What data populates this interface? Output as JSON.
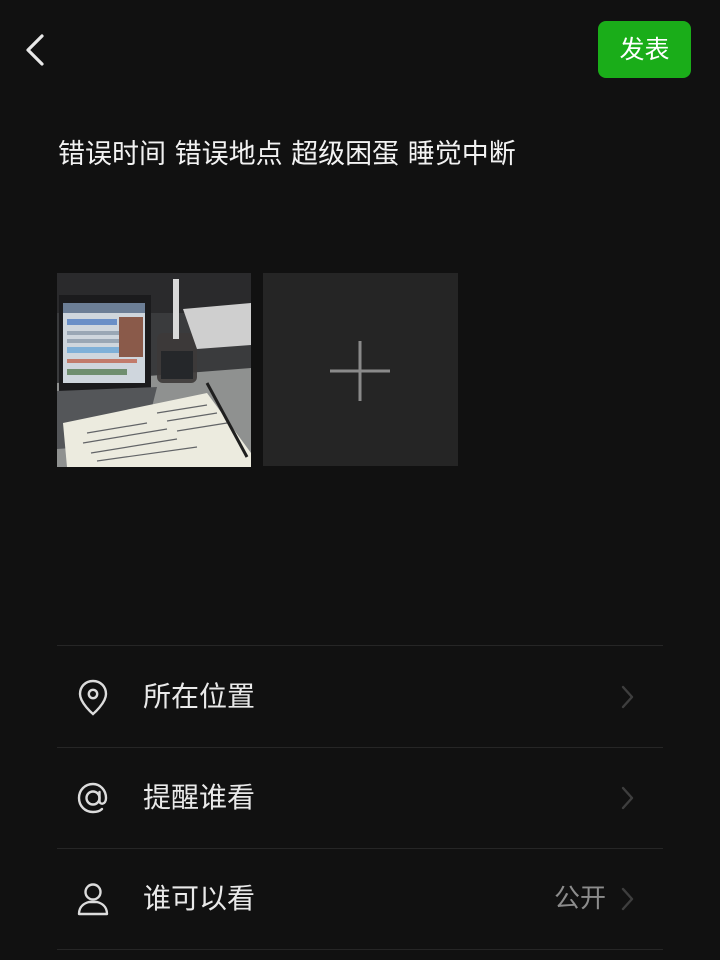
{
  "header": {
    "back_icon": "chevron-left-icon",
    "publish_label": "发表",
    "accent_color": "#1aad19"
  },
  "post": {
    "text": "错误时间 错误地点 超级困蛋 睡觉中断"
  },
  "media": {
    "photos": [
      "photo of laptop, handwritten notes and iced drink on a desk"
    ],
    "add_icon": "plus-icon"
  },
  "options": [
    {
      "icon": "location-pin-icon",
      "label": "所在位置",
      "value": ""
    },
    {
      "icon": "at-sign-icon",
      "label": "提醒谁看",
      "value": ""
    },
    {
      "icon": "person-icon",
      "label": "谁可以看",
      "value": "公开"
    }
  ],
  "colors": {
    "background": "#111111",
    "divider": "#262626",
    "muted_text": "#8c8c8c"
  }
}
